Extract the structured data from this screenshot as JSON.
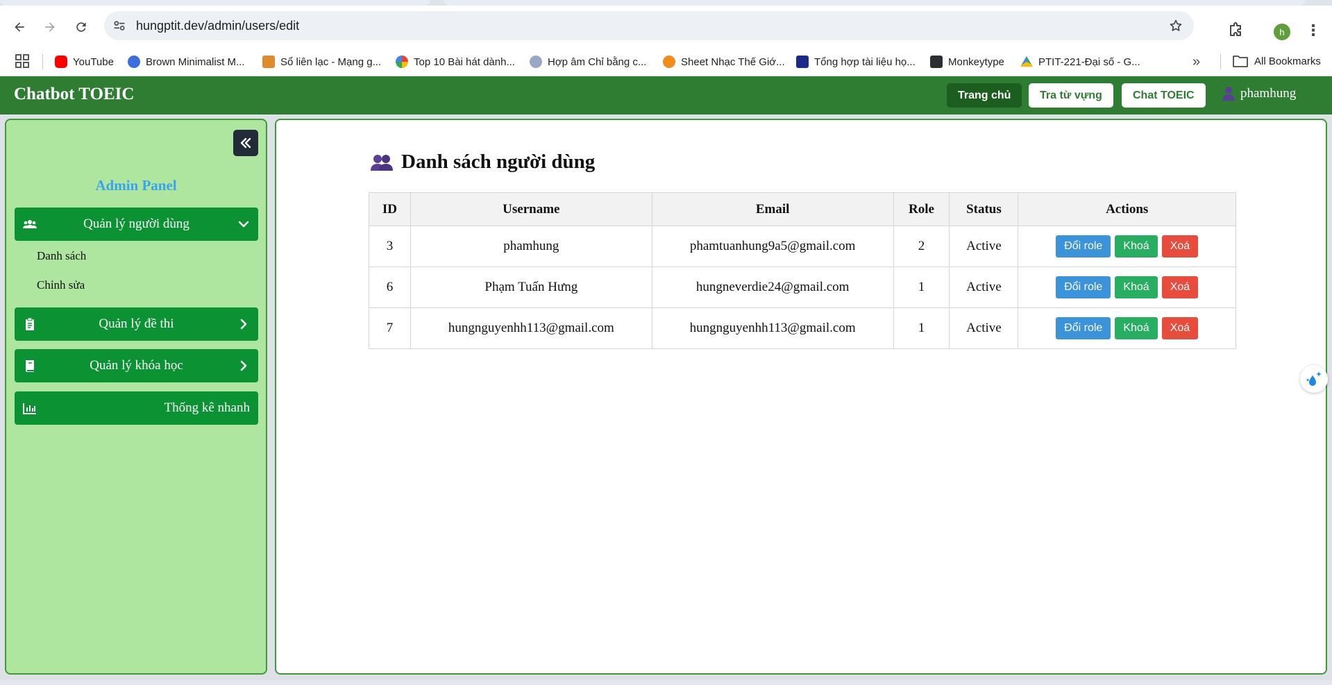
{
  "browser": {
    "url": "hungptit.dev/admin/users/edit",
    "profile_initial": "h",
    "bookmarks": [
      {
        "label": "YouTube",
        "color": "#ff0000"
      },
      {
        "label": "Brown Minimalist M...",
        "color": "#3b6fe0"
      },
      {
        "label": "Sổ liên lạc - Mạng g...",
        "color": "#e08a2e"
      },
      {
        "label": "Top 10 Bài hát dành...",
        "color": "#ea4335"
      },
      {
        "label": "Hợp âm Chỉ bằng c...",
        "color": "#9aa7c7"
      },
      {
        "label": "Sheet Nhạc Thế Giớ...",
        "color": "#f28c1a"
      },
      {
        "label": "Tổng hợp tài liệu họ...",
        "color": "#1b2a8a"
      },
      {
        "label": "Monkeytype",
        "color": "#2c2e31"
      },
      {
        "label": "PTIT-221-Đại số - G...",
        "color": "#34a853"
      }
    ],
    "all_bookmarks": "All Bookmarks"
  },
  "header": {
    "brand": "Chatbot TOEIC",
    "nav": [
      "Trang chủ",
      "Tra từ vựng",
      "Chat TOEIC"
    ],
    "username": "phamhung"
  },
  "sidebar": {
    "title": "Admin Panel",
    "items": [
      {
        "label": "Quản lý người dùng",
        "icon": "users-icon",
        "expanded": true
      },
      {
        "label": "Quản lý đề thi",
        "icon": "clipboard-icon"
      },
      {
        "label": "Quản lý khóa học",
        "icon": "book-icon"
      },
      {
        "label": "Thống kê nhanh",
        "icon": "chart-icon"
      }
    ],
    "sub_items": [
      "Danh sách",
      "Chỉnh sửa"
    ]
  },
  "main": {
    "title": "Danh sách người dùng",
    "columns": [
      "ID",
      "Username",
      "Email",
      "Role",
      "Status",
      "Actions"
    ],
    "rows": [
      {
        "id": "3",
        "username": "phamhung",
        "email": "phamtuanhung9a5@gmail.com",
        "role": "2",
        "status": "Active"
      },
      {
        "id": "6",
        "username": "Phạm Tuấn Hưng",
        "email": "hungneverdie24@gmail.com",
        "role": "1",
        "status": "Active"
      },
      {
        "id": "7",
        "username": "hungnguyenhh113@gmail.com",
        "email": "hungnguyenhh113@gmail.com",
        "role": "1",
        "status": "Active"
      }
    ],
    "actions": {
      "change_role": "Đổi role",
      "lock": "Khoá",
      "delete": "Xoá"
    }
  },
  "colors": {
    "header_green": "#2e7d32",
    "sidebar_bg": "#aee59f",
    "sidebar_item": "#0b9333",
    "role_button": "#3b94d9",
    "lock_button": "#27ae60",
    "delete_button": "#e74c3c"
  }
}
